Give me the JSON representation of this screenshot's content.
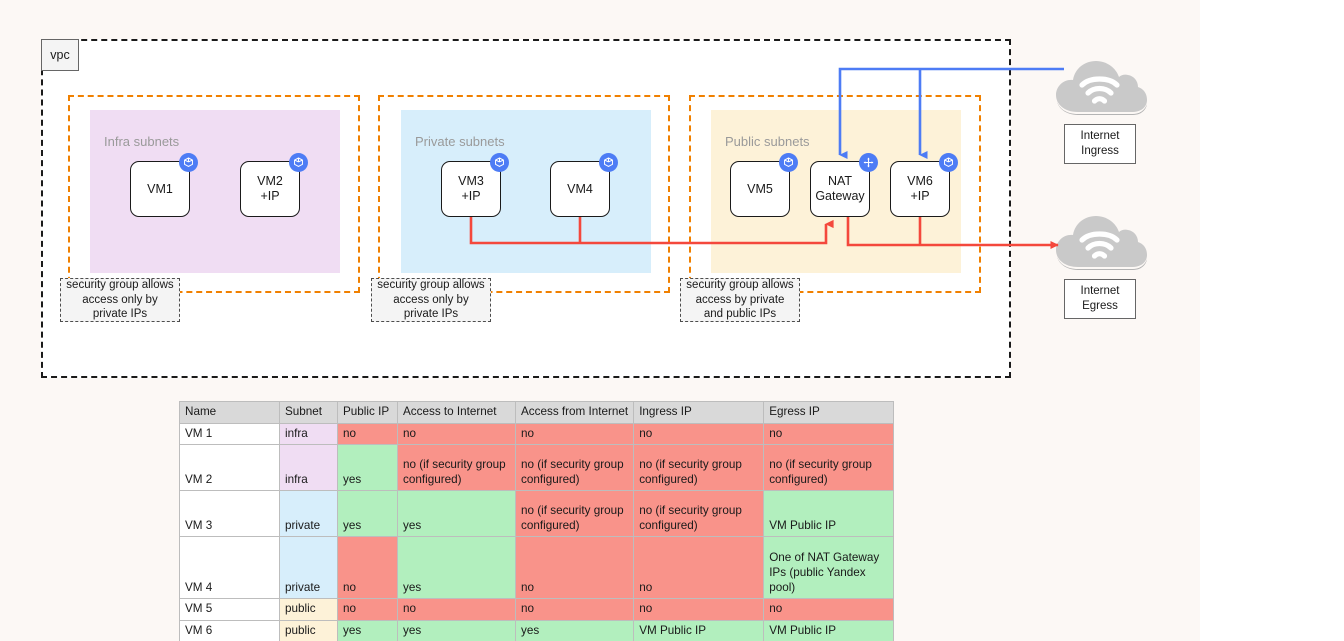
{
  "diagram": {
    "vpc_label": "vpc",
    "subnet_groups": [
      {
        "id": "infra",
        "label": "Infra subnets",
        "color": "#f0ddf3"
      },
      {
        "id": "private",
        "label": "Private subnets",
        "color": "#d7eefb"
      },
      {
        "id": "public",
        "label": "Public subnets",
        "color": "#fdf2d8"
      }
    ],
    "nodes": [
      {
        "id": "vm1",
        "line1": "VM1",
        "line2": "",
        "icon": "vm-cube-icon"
      },
      {
        "id": "vm2",
        "line1": "VM2",
        "line2": "+IP",
        "icon": "vm-cube-icon"
      },
      {
        "id": "vm3",
        "line1": "VM3",
        "line2": "+IP",
        "icon": "vm-cube-icon"
      },
      {
        "id": "vm4",
        "line1": "VM4",
        "line2": "",
        "icon": "vm-cube-icon"
      },
      {
        "id": "vm5",
        "line1": "VM5",
        "line2": "",
        "icon": "vm-cube-icon"
      },
      {
        "id": "nat",
        "line1": "NAT",
        "line2": "Gateway",
        "icon": "nat-gateway-icon"
      },
      {
        "id": "vm6",
        "line1": "VM6",
        "line2": "+IP",
        "icon": "vm-cube-icon"
      }
    ],
    "security_groups": [
      {
        "id": "infra",
        "text": "security group allows access only by private IPs"
      },
      {
        "id": "private",
        "text": "security group allows access only by private IPs"
      },
      {
        "id": "public",
        "text": "security group allows access by private and public IPs"
      }
    ],
    "clouds": [
      {
        "id": "ingress",
        "line1": "Internet",
        "line2": "Ingress",
        "icon": "internet-cloud-icon",
        "arrow_color": "#4d7cf5"
      },
      {
        "id": "egress",
        "line1": "Internet",
        "line2": "Egress",
        "icon": "internet-cloud-icon",
        "arrow_color": "#f4483c"
      }
    ],
    "colors": {
      "ingress_arrow": "#4d7cf5",
      "egress_arrow": "#f4483c",
      "subnet_border": "#f08000",
      "vpc_border": "#1a1a1a",
      "badge": "#4d7cf5"
    }
  },
  "table": {
    "headers": [
      "Name",
      "Subnet",
      "Public IP",
      "Access to Internet",
      "Access from Internet",
      "Ingress IP",
      "Egress IP"
    ],
    "rows": [
      {
        "name": "VM 1",
        "subnet": "infra",
        "public_ip": "no",
        "access_to": "no",
        "access_from": "no",
        "ingress_ip": "no",
        "egress_ip": "no",
        "state": {
          "public_ip": "red",
          "access_to": "red",
          "access_from": "red",
          "ingress_ip": "red",
          "egress_ip": "red"
        }
      },
      {
        "name": "VM 2",
        "subnet": "infra",
        "public_ip": "yes",
        "access_to": "no (if security group configured)",
        "access_from": "no (if security group configured)",
        "ingress_ip": "no (if security group configured)",
        "egress_ip": "no (if security group configured)",
        "state": {
          "public_ip": "green",
          "access_to": "red",
          "access_from": "red",
          "ingress_ip": "red",
          "egress_ip": "red"
        }
      },
      {
        "name": "VM 3",
        "subnet": "private",
        "public_ip": "yes",
        "access_to": "yes",
        "access_from": "no (if security group configured)",
        "ingress_ip": "no (if security group configured)",
        "egress_ip": "VM Public IP",
        "state": {
          "public_ip": "green",
          "access_to": "green",
          "access_from": "red",
          "ingress_ip": "red",
          "egress_ip": "green"
        }
      },
      {
        "name": "VM 4",
        "subnet": "private",
        "public_ip": "no",
        "access_to": "yes",
        "access_from": "no",
        "ingress_ip": "no",
        "egress_ip": "One of NAT Gateway IPs (public Yandex pool)",
        "state": {
          "public_ip": "red",
          "access_to": "green",
          "access_from": "red",
          "ingress_ip": "red",
          "egress_ip": "green"
        }
      },
      {
        "name": "VM 5",
        "subnet": "public",
        "public_ip": "no",
        "access_to": "no",
        "access_from": "no",
        "ingress_ip": "no",
        "egress_ip": "no",
        "state": {
          "public_ip": "red",
          "access_to": "red",
          "access_from": "red",
          "ingress_ip": "red",
          "egress_ip": "red"
        }
      },
      {
        "name": "VM 6",
        "subnet": "public",
        "public_ip": "yes",
        "access_to": "yes",
        "access_from": "yes",
        "ingress_ip": "VM Public IP",
        "egress_ip": "VM Public IP",
        "state": {
          "public_ip": "green",
          "access_to": "green",
          "access_from": "green",
          "ingress_ip": "green",
          "egress_ip": "green"
        }
      }
    ]
  }
}
